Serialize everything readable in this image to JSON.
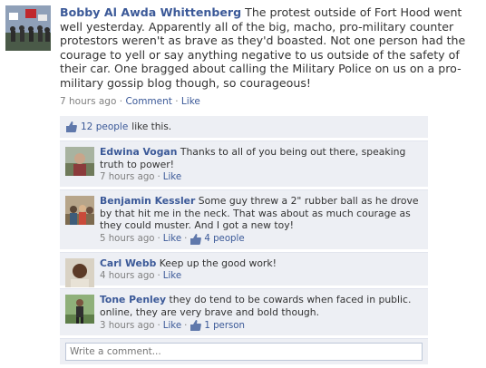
{
  "post": {
    "author": "Bobby Al Awda Whittenberg",
    "text": "The protest outside of Fort Hood went well yesterday. Apparently all of the big, macho, pro-military counter protestors weren't as brave as they'd boasted. Not one person had the courage to yell or say anything negative to us outside of the safety of their car. One bragged about calling the Military Police on us on a pro-military gossip blog though, so courageous!",
    "time": "7 hours ago",
    "sep": "·",
    "comment_label": "Comment",
    "like_label": "Like"
  },
  "likes": {
    "count_label": "12 people",
    "suffix": "like this."
  },
  "comments": [
    {
      "author": "Edwina Vogan",
      "text": "Thanks to all of you being out there, speaking truth to power!",
      "time": "7 hours ago",
      "like_label": "Like",
      "likes": ""
    },
    {
      "author": "Benjamin Kessler",
      "text": "Some guy threw a 2\" rubber ball as he drove by that hit me in the neck. That was about as much courage as they could muster. And I got a new toy!",
      "time": "5 hours ago",
      "like_label": "Like",
      "likes": "4 people"
    },
    {
      "author": "Carl Webb",
      "text": "Keep up the good work!",
      "time": "4 hours ago",
      "like_label": "Like",
      "likes": ""
    },
    {
      "author": "Tone Penley",
      "text": "they do tend to be cowards when faced in public. online, they are very brave and bold though.",
      "time": "3 hours ago",
      "like_label": "Like",
      "likes": "1 person"
    }
  ],
  "write_comment": {
    "placeholder": "Write a comment..."
  },
  "colors": {
    "link": "#3b5998",
    "feedback_bg": "#edeff4",
    "meta": "#808080"
  },
  "icons": {
    "like": "thumbs-up-icon"
  }
}
